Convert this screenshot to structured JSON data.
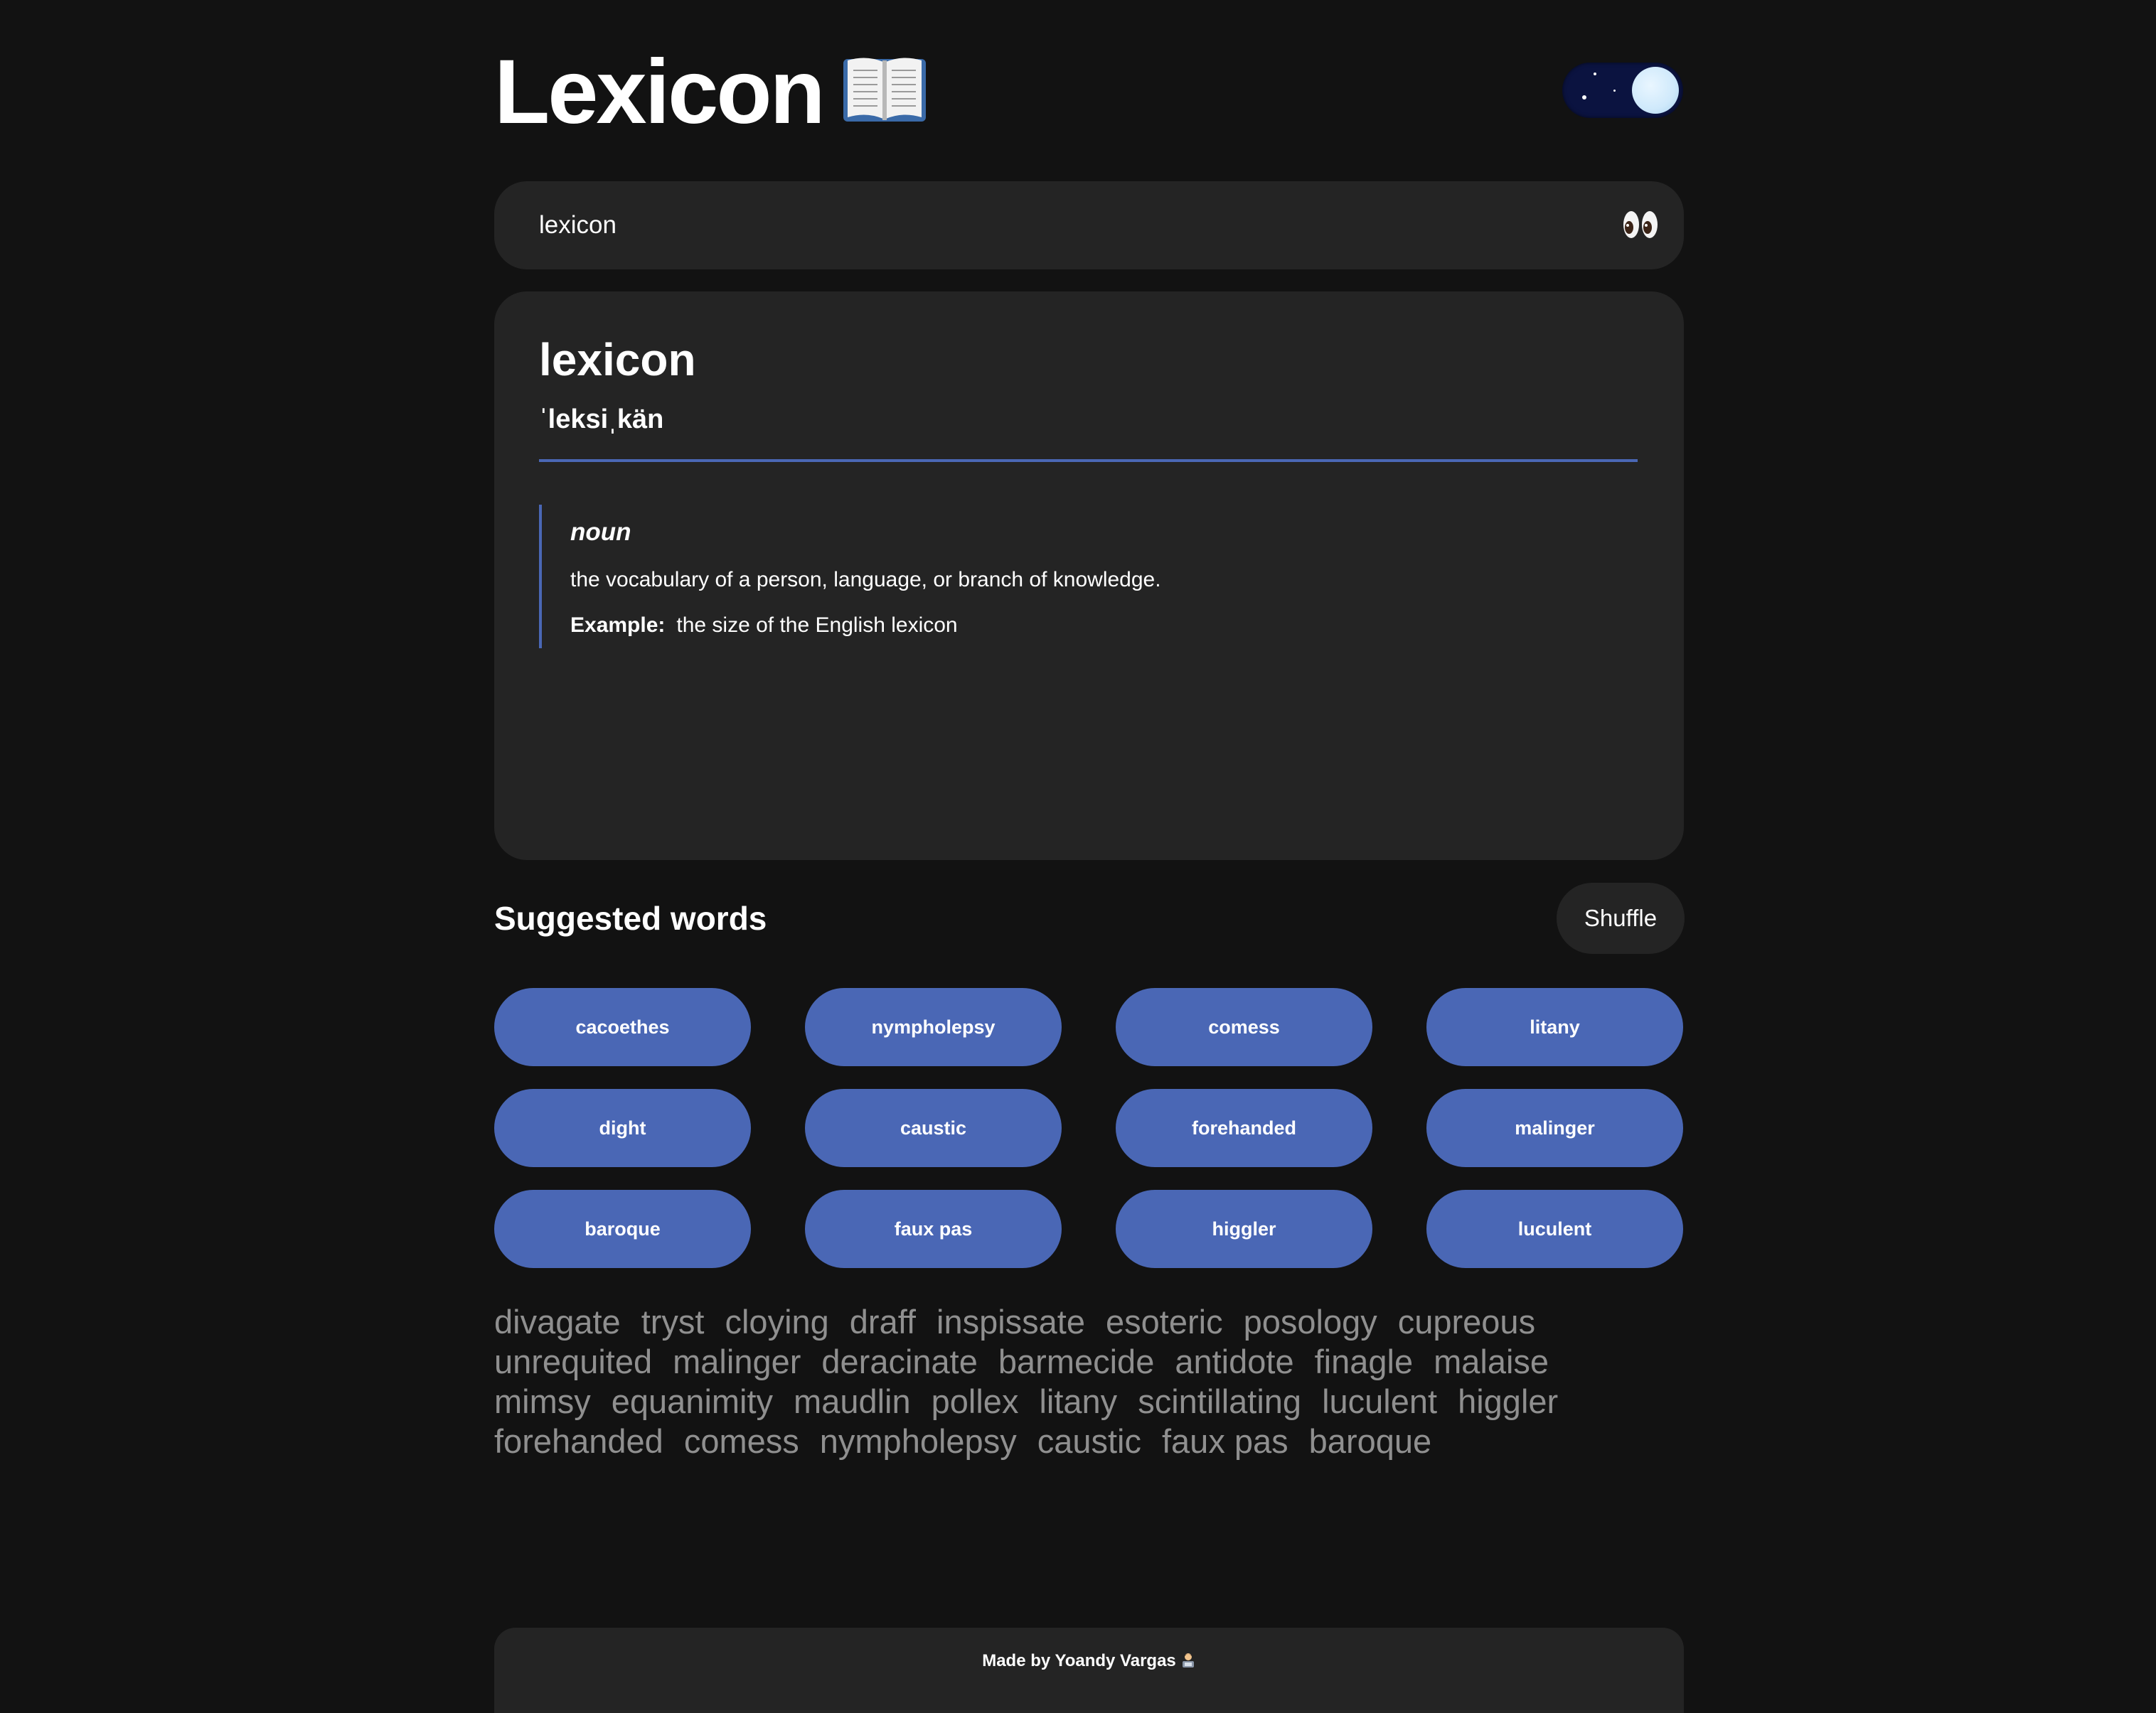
{
  "header": {
    "title": "Lexicon",
    "title_icon": "open-book-icon",
    "theme_toggle_icon": "moon-icon"
  },
  "search": {
    "value": "lexicon",
    "placeholder": "",
    "icon": "eyes-icon"
  },
  "entry": {
    "word": "lexicon",
    "phonetic": "ˈleksiˌkän",
    "meanings": [
      {
        "part_of_speech": "noun",
        "definition": "the vocabulary of a person, language, or branch of knowledge.",
        "example_label": "Example:",
        "example": "the size of the English lexicon"
      }
    ]
  },
  "suggested": {
    "title": "Suggested words",
    "shuffle_label": "Shuffle",
    "words": [
      "cacoethes",
      "nympholepsy",
      "comess",
      "litany",
      "dight",
      "caustic",
      "forehanded",
      "malinger",
      "baroque",
      "faux pas",
      "higgler",
      "luculent"
    ]
  },
  "word_cloud": [
    [
      "divagate",
      "tryst",
      "cloying",
      "draff",
      "inspissate",
      "esoteric",
      "posology",
      "cupreous"
    ],
    [
      "unrequited",
      "malinger",
      "deracinate",
      "barmecide",
      "antidote",
      "finagle",
      "malaise"
    ],
    [
      "mimsy",
      "equanimity",
      "maudlin",
      "pollex",
      "litany",
      "scintillating",
      "luculent",
      "higgler"
    ],
    [
      "forehanded",
      "comess",
      "nympholepsy",
      "caustic",
      "faux pas",
      "baroque"
    ]
  ],
  "footer": {
    "text": "Made by Yoandy Vargas",
    "emoji_icon": "technologist-icon"
  },
  "colors": {
    "background": "#121212",
    "surface": "#242424",
    "accent": "#4a67b5",
    "muted_text": "#8f8f8f",
    "toggle_track": "#0b1340"
  }
}
